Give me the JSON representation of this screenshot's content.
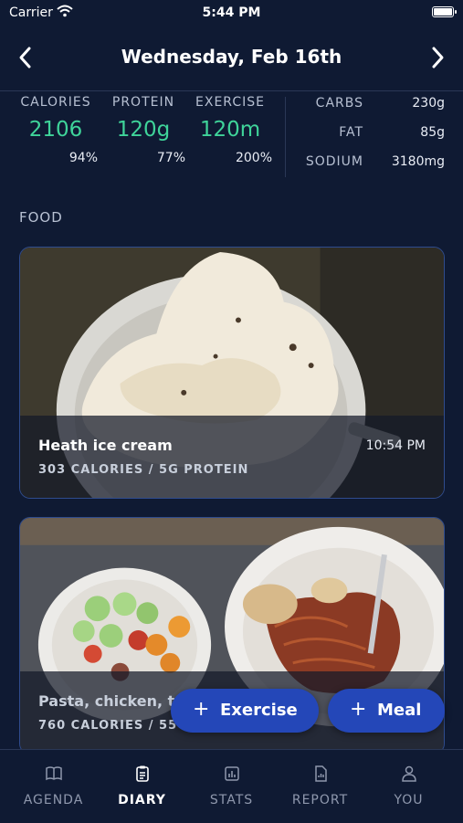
{
  "status_bar": {
    "carrier": "Carrier",
    "time": "5:44 PM"
  },
  "header": {
    "title": "Wednesday, Feb 16th"
  },
  "summary": {
    "calories": {
      "label": "CALORIES",
      "value": "2106",
      "percent": "94%"
    },
    "protein": {
      "label": "PROTEIN",
      "value": "120g",
      "percent": "77%"
    },
    "exercise": {
      "label": "EXERCISE",
      "value": "120m",
      "percent": "200%"
    },
    "carbs": {
      "label": "CARBS",
      "value": "230g"
    },
    "fat": {
      "label": "FAT",
      "value": "85g"
    },
    "sodium": {
      "label": "SODIUM",
      "value": "3180mg"
    }
  },
  "section": {
    "food_label": "FOOD"
  },
  "food_items": [
    {
      "name": "Heath ice cream",
      "time": "10:54 PM",
      "meta": "303 CALORIES / 5G PROTEIN"
    },
    {
      "name": "Pasta, chicken, to...",
      "meta": "760 CALORIES / 55G PROTEIN"
    }
  ],
  "actions": {
    "exercise_label": "Exercise",
    "meal_label": "Meal"
  },
  "tabs": [
    {
      "label": "AGENDA",
      "icon": "book-icon"
    },
    {
      "label": "DIARY",
      "icon": "clipboard-icon",
      "active": true
    },
    {
      "label": "STATS",
      "icon": "chart-icon"
    },
    {
      "label": "REPORT",
      "icon": "report-icon"
    },
    {
      "label": "YOU",
      "icon": "person-icon"
    }
  ],
  "colors": {
    "background": "#0f1a33",
    "accent_green": "#3fd49a",
    "button_blue": "#2447b8"
  }
}
